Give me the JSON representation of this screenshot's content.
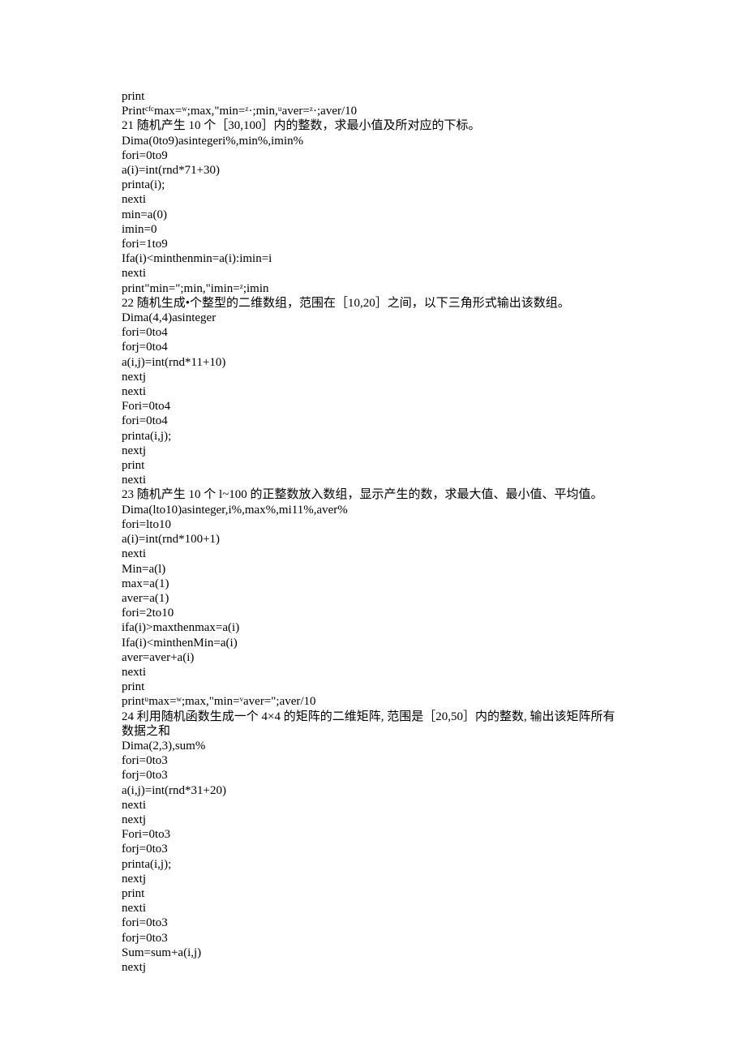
{
  "lines": [
    "print",
    "Printᶜᶠᶜmax=ʷ;max,\"min=ᶻ·;min,ᵘaver=ᶻ·;aver/10",
    "21 随机产生 10 个［30,100］内的整数，求最小值及所对应的下标。",
    "Dima(0to9)asintegeri%,min%,imin%",
    "fori=0to9",
    "a(i)=int(rnd*71+30)",
    "printa(i);",
    "nexti",
    "min=a(0)",
    "imin=0",
    "fori=1to9",
    "Ifa(i)<minthenmin=a(i):imin=i",
    "nexti",
    "print\"min=\";min,\"imin=ᶻ;imin",
    "22 随机生成•个整型的二维数组，范围在［10,20］之间，以下三角形式输出该数组。",
    "Dima(4,4)asinteger",
    "fori=0to4",
    "forj=0to4",
    "a(i,j)=int(rnd*11+10)",
    "nextj",
    "nexti",
    "Fori=0to4",
    "fori=0to4",
    "printa(i,j);",
    "nextj",
    "print",
    "nexti",
    "23 随机产生 10 个 l~100 的正整数放入数组，显示产生的数，求最大值、最小值、平均值。",
    "Dima(lto10)asinteger,i%,max%,mi11%,aver%",
    "fori=lto10",
    "a(i)=int(rnd*100+1)",
    "nexti",
    "Min=a(l)",
    "max=a(1)",
    "aver=a(1)",
    "fori=2to10",
    "ifa(i)>maxthenmax=a(i)",
    "Ifa(i)<minthenMin=a(i)",
    "aver=aver+a(i)",
    "nexti",
    "print",
    "printᵘmax=ʷ;max,\"min=ᵛaver=\";aver/10",
    "24 利用随机函数生成一个 4×4 的矩阵的二维矩阵, 范围是［20,50］内的整数, 输出该矩阵所有",
    "数据之和",
    "Dima(2,3),sum%",
    "fori=0to3",
    "forj=0to3",
    "a(i,j)=int(rnd*31+20)",
    "nexti",
    "nextj",
    "Fori=0to3",
    "forj=0to3",
    "printa(i,j);",
    "nextj",
    "print",
    "nexti",
    "fori=0to3",
    "forj=0to3",
    "Sum=sum+a(i,j)",
    "nextj"
  ]
}
